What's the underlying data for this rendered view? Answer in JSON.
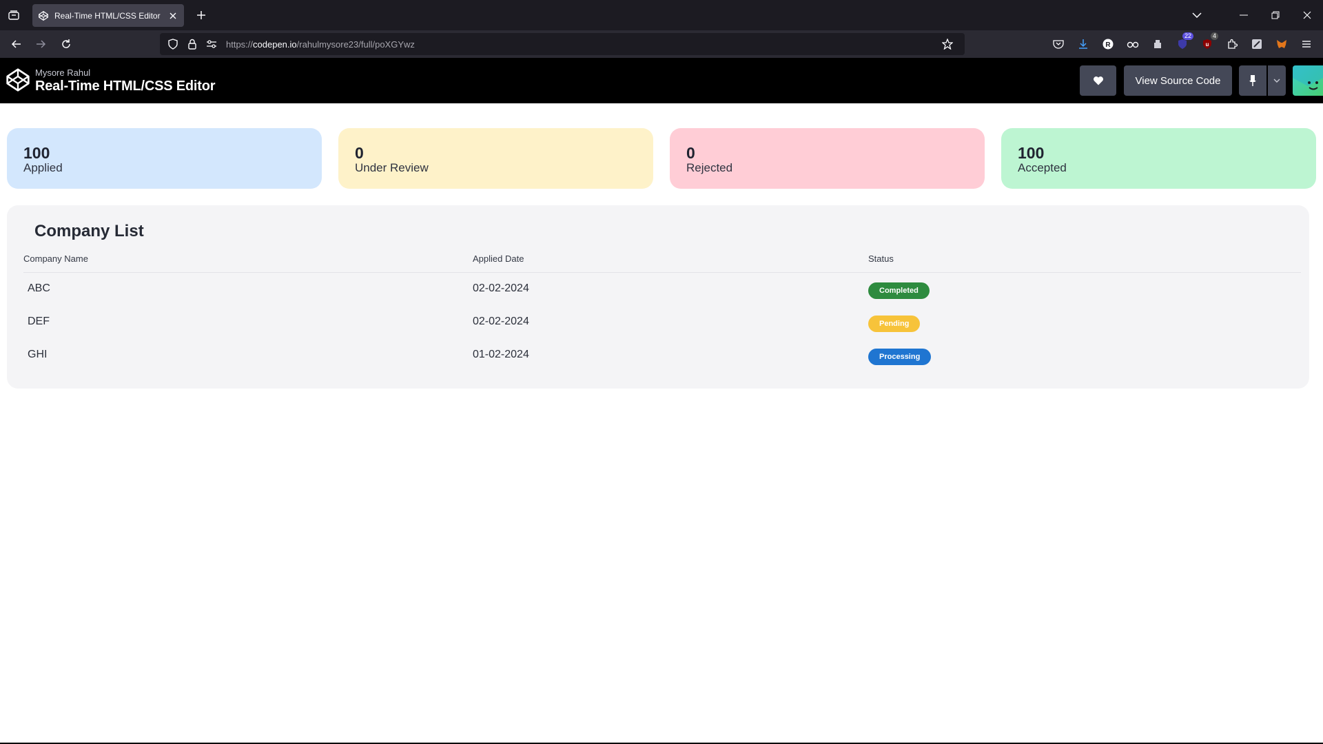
{
  "browser": {
    "tab_title": "Real-Time HTML/CSS Editor",
    "url_prefix": "https://",
    "url_domain": "codepen.io",
    "url_path": "/rahulmysore23/full/poXGYwz",
    "ext_badge_1": "22",
    "ext_badge_2": "4"
  },
  "codepen": {
    "author": "Mysore Rahul",
    "title": "Real-Time HTML/CSS Editor",
    "view_source_label": "View Source Code"
  },
  "stats": [
    {
      "value": "100",
      "label": "Applied",
      "color": "#d3e7fd"
    },
    {
      "value": "0",
      "label": "Under Review",
      "color": "#fef2c9"
    },
    {
      "value": "0",
      "label": "Rejected",
      "color": "#ffcdd6"
    },
    {
      "value": "100",
      "label": "Accepted",
      "color": "#bdf5d2"
    }
  ],
  "company_list": {
    "title": "Company List",
    "columns": [
      "Company Name",
      "Applied Date",
      "Status"
    ],
    "rows": [
      {
        "company": "ABC",
        "date": "02-02-2024",
        "status": "Completed",
        "status_color": "#2e8b3f"
      },
      {
        "company": "DEF",
        "date": "02-02-2024",
        "status": "Pending",
        "status_color": "#f7c33a"
      },
      {
        "company": "GHI",
        "date": "01-02-2024",
        "status": "Processing",
        "status_color": "#1f75d1"
      }
    ]
  }
}
